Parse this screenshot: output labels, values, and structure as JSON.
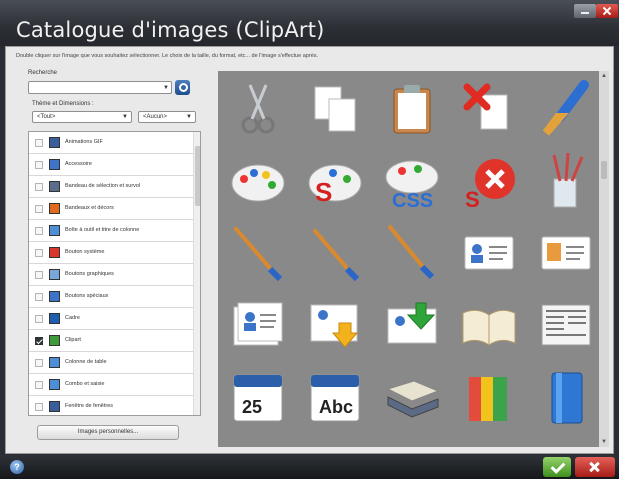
{
  "window": {
    "title": "Catalogue d'images (ClipArt)",
    "instruction": "Double cliquer sur l'image que vous souhaitez sélectionner. Le choix de la taille, du format, etc... de l'image s'effectue après."
  },
  "search": {
    "label": "Recherche",
    "value": "",
    "button_icon": "search-icon"
  },
  "theme": {
    "label": "Thème et Dimensions :",
    "theme_value": "<Tout>",
    "size_value": "<Aucun>"
  },
  "categories": [
    {
      "label": "Animations GIF",
      "checked": false,
      "icon_color": "#3a5e9a"
    },
    {
      "label": "Accessoire",
      "checked": false,
      "icon_color": "#3b74c9"
    },
    {
      "label": "Bandeau de sélection et survol",
      "checked": false,
      "icon_color": "#5a6d8a"
    },
    {
      "label": "Bandeaux et décors",
      "checked": false,
      "icon_color": "#e06a1d"
    },
    {
      "label": "Boîte à outil et titre de colonne",
      "checked": false,
      "icon_color": "#4d8fd6"
    },
    {
      "label": "Bouton système",
      "checked": false,
      "icon_color": "#d9362c"
    },
    {
      "label": "Boutons graphiques",
      "checked": false,
      "icon_color": "#7aa7d9"
    },
    {
      "label": "Boutons spéciaux",
      "checked": false,
      "icon_color": "#3b74c9"
    },
    {
      "label": "Cadre",
      "checked": false,
      "icon_color": "#1f5fb0"
    },
    {
      "label": "Clipart",
      "checked": true,
      "icon_color": "#3f9a3a"
    },
    {
      "label": "Colonne de table",
      "checked": false,
      "icon_color": "#4d8fd6"
    },
    {
      "label": "Combo et saisie",
      "checked": false,
      "icon_color": "#4d8fd6"
    },
    {
      "label": "Fenêtre de fenêtres",
      "checked": false,
      "icon_color": "#3a5e9a"
    }
  ],
  "buttons": {
    "images_perso": "Images personnelles...",
    "help": "?",
    "ok": "ok-icon",
    "cancel": "cancel-icon"
  },
  "gallery": [
    {
      "name": "scissors",
      "label": ""
    },
    {
      "name": "copy-pages",
      "label": ""
    },
    {
      "name": "clipboard",
      "label": ""
    },
    {
      "name": "delete-page",
      "label": ""
    },
    {
      "name": "paintbrush",
      "label": ""
    },
    {
      "name": "palette",
      "label": ""
    },
    {
      "name": "palette-s",
      "label": ""
    },
    {
      "name": "palette-css",
      "label": "CSS"
    },
    {
      "name": "s-delete",
      "label": ""
    },
    {
      "name": "brush-cup",
      "label": ""
    },
    {
      "name": "brush-1",
      "label": ""
    },
    {
      "name": "brush-2",
      "label": ""
    },
    {
      "name": "brush-3",
      "label": ""
    },
    {
      "name": "id-card",
      "label": ""
    },
    {
      "name": "id-card-orange",
      "label": ""
    },
    {
      "name": "contacts",
      "label": ""
    },
    {
      "name": "contact-download",
      "label": ""
    },
    {
      "name": "contact-import",
      "label": ""
    },
    {
      "name": "open-book",
      "label": ""
    },
    {
      "name": "newspaper",
      "label": ""
    },
    {
      "name": "calendar",
      "label": "25"
    },
    {
      "name": "abc-calendar",
      "label": "Abc"
    },
    {
      "name": "books-stack",
      "label": ""
    },
    {
      "name": "binders",
      "label": ""
    },
    {
      "name": "blue-binder",
      "label": ""
    }
  ]
}
